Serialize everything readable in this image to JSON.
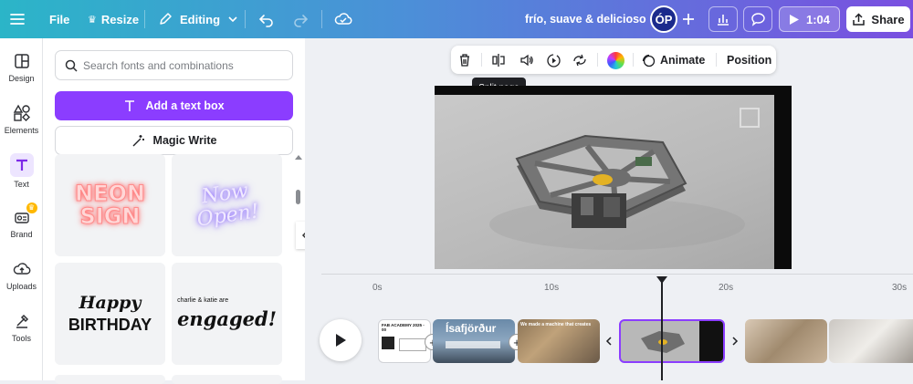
{
  "topbar": {
    "file": "File",
    "resize": "Resize",
    "editing": "Editing",
    "doc_title": "frío, suave & delicioso",
    "avatar_initials": "ÓP",
    "play_time": "1:04",
    "share": "Share"
  },
  "rail": {
    "items": [
      {
        "label": "Design",
        "icon": "design-icon"
      },
      {
        "label": "Elements",
        "icon": "elements-icon"
      },
      {
        "label": "Text",
        "icon": "text-icon"
      },
      {
        "label": "Brand",
        "icon": "brand-icon"
      },
      {
        "label": "Uploads",
        "icon": "uploads-icon"
      },
      {
        "label": "Tools",
        "icon": "tools-icon"
      }
    ]
  },
  "panel": {
    "search_placeholder": "Search fonts and combinations",
    "add_text_box": "Add a text box",
    "magic_write": "Magic Write",
    "tiles": {
      "neon_line1": "NEON",
      "neon_line2": "SIGN",
      "now_line1": "Now",
      "now_line2": "Open!",
      "happy": "Happy",
      "birthday": "BIRTHDAY",
      "engaged_small": "charlie & katie are",
      "engaged": "engaged!"
    }
  },
  "context_toolbar": {
    "animate": "Animate",
    "position": "Position",
    "tooltip": "Split page"
  },
  "timeline": {
    "ticks": [
      "0s",
      "10s",
      "20s",
      "30s"
    ],
    "clips": {
      "c1_title": "FAB ACADEMY 2025 - 00",
      "c2_title": "Ísafjörður",
      "c3_title": "We made a machine that creates"
    }
  }
}
